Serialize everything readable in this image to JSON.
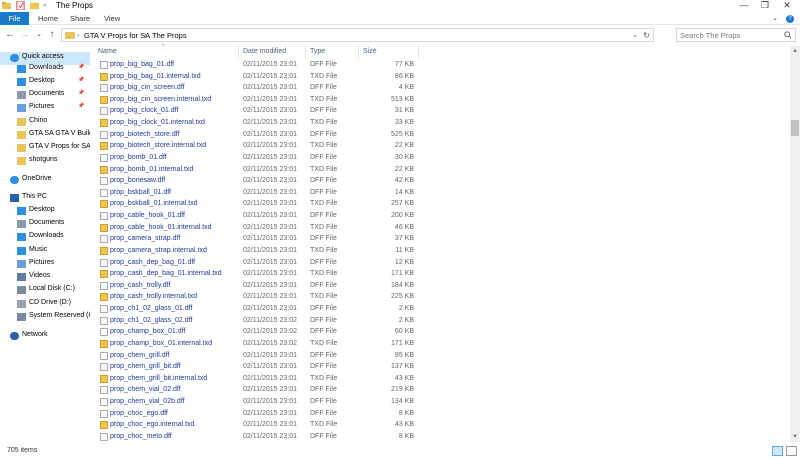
{
  "window": {
    "title": "The Props",
    "minimize": "—",
    "maximize": "❐",
    "close": "✕"
  },
  "ribbon": {
    "tabs": [
      "File",
      "Home",
      "Share",
      "View"
    ],
    "expand": "⌄",
    "help": "?"
  },
  "address": {
    "back": "←",
    "forward": "→",
    "recent": "⌄",
    "up": "↑",
    "crumbs": [
      "GTA V Props for SA",
      "The Props"
    ],
    "separator": "›",
    "dropdown": "⌄",
    "refresh": "↻"
  },
  "search": {
    "placeholder": "Search The Props"
  },
  "nav": {
    "items": [
      {
        "label": "Quick access",
        "icon": "star-icon",
        "pinned": false
      },
      {
        "label": "Downloads",
        "icon": "download-icon",
        "pinned": true
      },
      {
        "label": "Desktop",
        "icon": "desktop-icon",
        "pinned": true
      },
      {
        "label": "Documents",
        "icon": "documents-icon",
        "pinned": true
      },
      {
        "label": "Pictures",
        "icon": "pictures-icon",
        "pinned": true
      },
      {
        "label": "Chino",
        "icon": "folder-icon",
        "pinned": false
      },
      {
        "label": "GTA SA GTA V Build",
        "icon": "folder-icon",
        "pinned": false
      },
      {
        "label": "GTA V Props for SA",
        "icon": "folder-icon",
        "pinned": false
      },
      {
        "label": "shotguns",
        "icon": "folder-icon",
        "pinned": false
      },
      {
        "label": "OneDrive",
        "icon": "cloud-icon",
        "pinned": false
      },
      {
        "label": "This PC",
        "icon": "computer-icon",
        "pinned": false
      },
      {
        "label": "Desktop",
        "icon": "desktop-icon",
        "pinned": false
      },
      {
        "label": "Documents",
        "icon": "documents-icon",
        "pinned": false
      },
      {
        "label": "Downloads",
        "icon": "download-icon",
        "pinned": false
      },
      {
        "label": "Music",
        "icon": "music-icon",
        "pinned": false
      },
      {
        "label": "Pictures",
        "icon": "pictures-icon",
        "pinned": false
      },
      {
        "label": "Videos",
        "icon": "videos-icon",
        "pinned": false
      },
      {
        "label": "Local Disk (C:)",
        "icon": "disk-icon",
        "pinned": false
      },
      {
        "label": "CD Drive (D:)",
        "icon": "cd-drive-icon",
        "pinned": false
      },
      {
        "label": "System Reserved (G",
        "icon": "disk-icon",
        "pinned": false
      },
      {
        "label": "Network",
        "icon": "network-icon",
        "pinned": false
      }
    ]
  },
  "columns": {
    "name": "Name",
    "date": "Date modified",
    "type": "Type",
    "size": "Size",
    "sort": "^"
  },
  "files": [
    {
      "name": "prop_big_bag_01.dff",
      "date": "02/11/2015 23:01",
      "type": "DFF File",
      "size": "77 KB"
    },
    {
      "name": "prop_big_bag_01.internal.txd",
      "date": "02/11/2015 23:01",
      "type": "TXD File",
      "size": "86 KB"
    },
    {
      "name": "prop_big_cin_screen.dff",
      "date": "02/11/2015 23:01",
      "type": "DFF File",
      "size": "4 KB"
    },
    {
      "name": "prop_big_cin_screen.internal.txd",
      "date": "02/11/2015 23:01",
      "type": "TXD File",
      "size": "513 KB"
    },
    {
      "name": "prop_big_clock_01.dff",
      "date": "02/11/2015 23:01",
      "type": "DFF File",
      "size": "31 KB"
    },
    {
      "name": "prop_big_clock_01.internal.txd",
      "date": "02/11/2015 23:01",
      "type": "TXD File",
      "size": "33 KB"
    },
    {
      "name": "prop_biotech_store.dff",
      "date": "02/11/2015 23:01",
      "type": "DFF File",
      "size": "525 KB"
    },
    {
      "name": "prop_biotech_store.internal.txd",
      "date": "02/11/2015 23:01",
      "type": "TXD File",
      "size": "22 KB"
    },
    {
      "name": "prop_bomb_01.dff",
      "date": "02/11/2015 23:01",
      "type": "DFF File",
      "size": "30 KB"
    },
    {
      "name": "prop_bomb_01.internal.txd",
      "date": "02/11/2015 23:01",
      "type": "TXD File",
      "size": "22 KB"
    },
    {
      "name": "prop_bonesaw.dff",
      "date": "02/11/2015 23:01",
      "type": "DFF File",
      "size": "42 KB"
    },
    {
      "name": "prop_bskball_01.dff",
      "date": "02/11/2015 23:01",
      "type": "DFF File",
      "size": "14 KB"
    },
    {
      "name": "prop_bskball_01.internal.txd",
      "date": "02/11/2015 23:01",
      "type": "TXD File",
      "size": "257 KB"
    },
    {
      "name": "prop_cable_hook_01.dff",
      "date": "02/11/2015 23:01",
      "type": "DFF File",
      "size": "200 KB"
    },
    {
      "name": "prop_cable_hook_01.internal.txd",
      "date": "02/11/2015 23:01",
      "type": "TXD File",
      "size": "46 KB"
    },
    {
      "name": "prop_camera_strap.dff",
      "date": "02/11/2015 23:01",
      "type": "DFF File",
      "size": "37 KB"
    },
    {
      "name": "prop_camera_strap.internal.txd",
      "date": "02/11/2015 23:01",
      "type": "TXD File",
      "size": "11 KB"
    },
    {
      "name": "prop_cash_dep_bag_01.dff",
      "date": "02/11/2015 23:01",
      "type": "DFF File",
      "size": "12 KB"
    },
    {
      "name": "prop_cash_dep_bag_01.internal.txd",
      "date": "02/11/2015 23:01",
      "type": "TXD File",
      "size": "171 KB"
    },
    {
      "name": "prop_cash_trolly.dff",
      "date": "02/11/2015 23:01",
      "type": "DFF File",
      "size": "184 KB"
    },
    {
      "name": "prop_cash_trolly.internal.txd",
      "date": "02/11/2015 23:01",
      "type": "TXD File",
      "size": "225 KB"
    },
    {
      "name": "prop_ch1_02_glass_01.dff",
      "date": "02/11/2015 23:01",
      "type": "DFF File",
      "size": "2 KB"
    },
    {
      "name": "prop_ch1_02_glass_02.dff",
      "date": "02/11/2015 23:02",
      "type": "DFF File",
      "size": "2 KB"
    },
    {
      "name": "prop_champ_box_01.dff",
      "date": "02/11/2015 23:02",
      "type": "DFF File",
      "size": "60 KB"
    },
    {
      "name": "prop_champ_box_01.internal.txd",
      "date": "02/11/2015 23:02",
      "type": "TXD File",
      "size": "171 KB"
    },
    {
      "name": "prop_chem_grill.dff",
      "date": "02/11/2015 23:01",
      "type": "DFF File",
      "size": "95 KB"
    },
    {
      "name": "prop_chem_grill_bit.dff",
      "date": "02/11/2015 23:01",
      "type": "DFF File",
      "size": "137 KB"
    },
    {
      "name": "prop_chem_grill_bit.internal.txd",
      "date": "02/11/2015 23:01",
      "type": "TXD File",
      "size": "43 KB"
    },
    {
      "name": "prop_chem_vial_02.dff",
      "date": "02/11/2015 23:01",
      "type": "DFF File",
      "size": "219 KB"
    },
    {
      "name": "prop_chem_vial_02b.dff",
      "date": "02/11/2015 23:01",
      "type": "DFF File",
      "size": "134 KB"
    },
    {
      "name": "prop_choc_ego.dff",
      "date": "02/11/2015 23:01",
      "type": "DFF File",
      "size": "8 KB"
    },
    {
      "name": "prop_choc_ego.internal.txd",
      "date": "02/11/2015 23:01",
      "type": "TXD File",
      "size": "43 KB"
    },
    {
      "name": "prop_choc_meto.dff",
      "date": "02/11/2015 23:01",
      "type": "DFF File",
      "size": "8 KB"
    }
  ],
  "status": {
    "count": "705 items"
  },
  "scroll": {
    "up": "▲",
    "down": "▼"
  },
  "colors": {
    "accent": "#1979ca",
    "link": "#1f3a99",
    "folder": "#e8c45a",
    "selection": "#cce8ff"
  }
}
